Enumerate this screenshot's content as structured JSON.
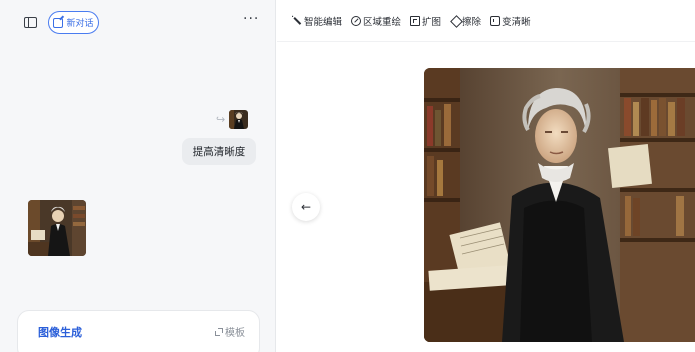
{
  "left_panel": {
    "new_chat_label": "新对话",
    "more_label": "···",
    "user_message": "提高清晰度",
    "reply_arrow": "↪",
    "bottom_card": {
      "title": "图像生成",
      "template_label": "模板"
    }
  },
  "toolbar": {
    "items": [
      {
        "icon": "magic-wand-icon",
        "label": "智能编辑"
      },
      {
        "icon": "brush-icon",
        "label": "区域重绘"
      },
      {
        "icon": "expand-icon",
        "label": "扩图"
      },
      {
        "icon": "eraser-icon",
        "label": "擦除"
      },
      {
        "icon": "hd-icon",
        "label": "变清晰"
      }
    ]
  },
  "viewer": {
    "back_label": "←"
  },
  "colors": {
    "accent": "#3b6fe6",
    "panel_bg": "#f6f7f9",
    "bubble_bg": "#eaecef"
  }
}
